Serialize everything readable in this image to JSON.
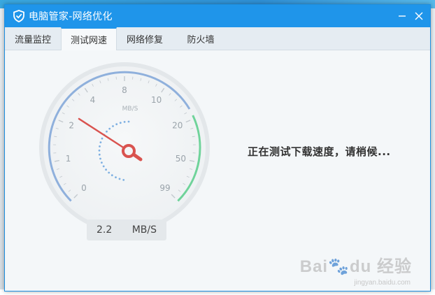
{
  "window": {
    "title": "电脑管家-网络优化",
    "minimize_glyph": "—",
    "close_glyph": "✕"
  },
  "tabs": [
    {
      "label": "流量监控",
      "active": false
    },
    {
      "label": "测试网速",
      "active": true
    },
    {
      "label": "网络修复",
      "active": false
    },
    {
      "label": "防火墙",
      "active": false
    }
  ],
  "gauge": {
    "unit_label": "MB/S",
    "tick_labels": [
      "0",
      "1",
      "2",
      "4",
      "8",
      "10",
      "20",
      "50",
      "99"
    ],
    "current_value": 2.2,
    "colors": {
      "arc_blue": "#8fb0dc",
      "arc_green": "#6fd39a",
      "needle": "#d9534f"
    }
  },
  "readout": {
    "value": "2.2",
    "unit": "MB/S"
  },
  "status_text": "正在测试下载速度，请梢候...",
  "watermark": {
    "main": "Bai du 经验",
    "sub": "jingyan.baidu.com"
  },
  "colors": {
    "titlebar": "#1f95ea",
    "accent": "#1f95ea"
  }
}
